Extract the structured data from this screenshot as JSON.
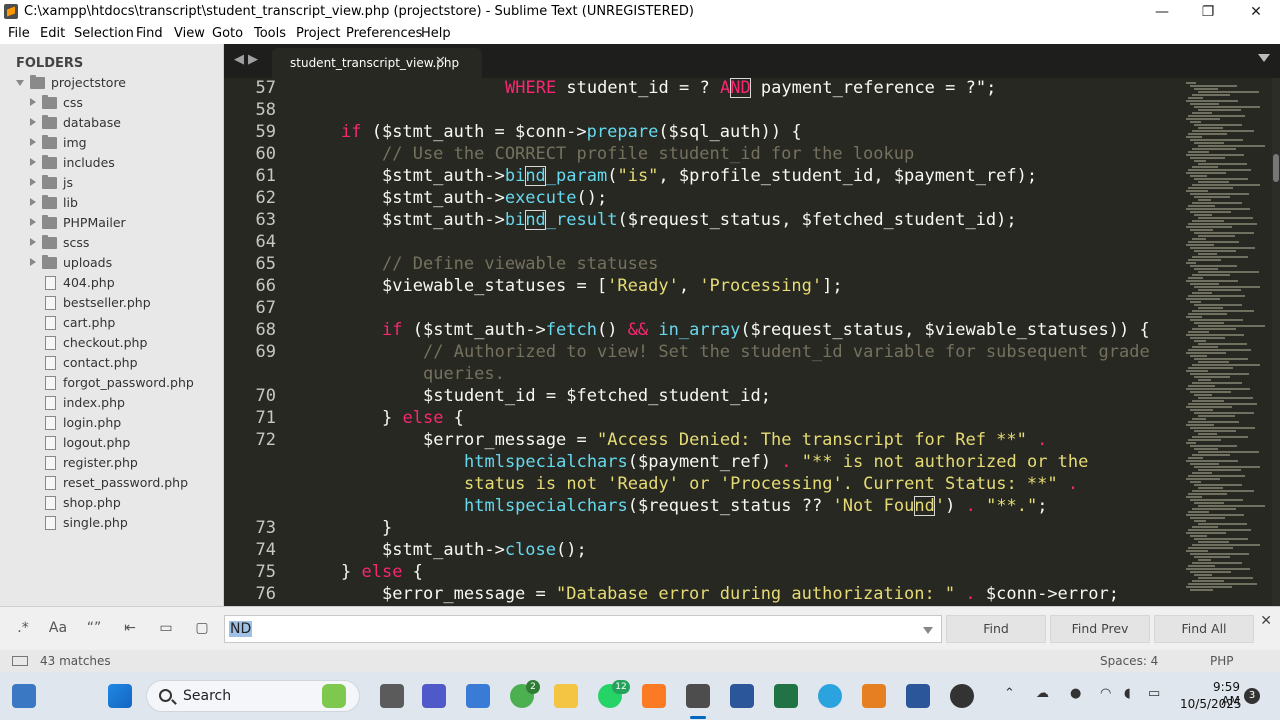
{
  "window": {
    "title": "C:\\xampp\\htdocs\\transcript\\student_transcript_view.php (projectstore) - Sublime Text (UNREGISTERED)",
    "minimize": "—",
    "maximize": "❐",
    "close": "✕"
  },
  "menu": [
    "File",
    "Edit",
    "Selection",
    "Find",
    "View",
    "Goto",
    "Tools",
    "Project",
    "Preferences",
    "Help"
  ],
  "sidebar": {
    "heading": "FOLDERS",
    "root": "projectstore",
    "folders": [
      "css",
      "database",
      "img",
      "includes",
      "js",
      "lib",
      "PHPMailer",
      "scss",
      "uploads"
    ],
    "files": [
      "404.php",
      "bestseller.php",
      "cart.php",
      "checkout.php",
      "contact.php",
      "forgot_password.php",
      "index.php",
      "login.php",
      "logout.php",
      "register.php",
      "reset_password.php",
      "shop.php",
      "single.php"
    ]
  },
  "tabs": {
    "nav_left": "◀",
    "nav_right": "▶",
    "active_tab": "student_transcript_view.php",
    "tab_close": "✕"
  },
  "editor": {
    "lines": [
      {
        "n": "57",
        "indent": 10,
        "parts": [
          [
            "kw",
            "WHERE "
          ],
          [
            "var",
            "student_id = ? "
          ],
          [
            "kw",
            "A"
          ],
          [
            "kwhl",
            "ND"
          ],
          [
            "var",
            " payment_reference = ?\";"
          ]
        ]
      },
      {
        "n": "58",
        "indent": 0,
        "parts": []
      },
      {
        "n": "59",
        "indent": 2,
        "parts": [
          [
            "kw",
            "if"
          ],
          [
            "var",
            " ($stmt_auth = $conn->"
          ],
          [
            "fn",
            "prepare"
          ],
          [
            "var",
            "($sql_auth)) {"
          ]
        ]
      },
      {
        "n": "60",
        "indent": 4,
        "parts": [
          [
            "cmt",
            "// Use the CORRECT profile student_id for the lookup"
          ]
        ]
      },
      {
        "n": "61",
        "indent": 4,
        "parts": [
          [
            "var",
            "$stmt_auth->"
          ],
          [
            "fn",
            "bi"
          ],
          [
            "fnhl",
            "nd"
          ],
          [
            "fn",
            "_param"
          ],
          [
            "var",
            "("
          ],
          [
            "str",
            "\"is\""
          ],
          [
            "var",
            ", $profile_student_id, $payment_ref);"
          ]
        ]
      },
      {
        "n": "62",
        "indent": 4,
        "parts": [
          [
            "var",
            "$stmt_auth->"
          ],
          [
            "fn",
            "execute"
          ],
          [
            "var",
            "();"
          ]
        ]
      },
      {
        "n": "63",
        "indent": 4,
        "parts": [
          [
            "var",
            "$stmt_auth->"
          ],
          [
            "fn",
            "bi"
          ],
          [
            "fnhl",
            "nd"
          ],
          [
            "fn",
            "_result"
          ],
          [
            "var",
            "($request_status, $fetched_student_id);"
          ]
        ]
      },
      {
        "n": "64",
        "indent": 0,
        "parts": []
      },
      {
        "n": "65",
        "indent": 4,
        "parts": [
          [
            "cmt",
            "// Define viewable statuses"
          ]
        ]
      },
      {
        "n": "66",
        "indent": 4,
        "parts": [
          [
            "var",
            "$viewable_statuses = ["
          ],
          [
            "str",
            "'Ready'"
          ],
          [
            "var",
            ", "
          ],
          [
            "str",
            "'Processing'"
          ],
          [
            "var",
            "];"
          ]
        ]
      },
      {
        "n": "67",
        "indent": 0,
        "parts": []
      },
      {
        "n": "68",
        "indent": 4,
        "parts": [
          [
            "kw",
            "if"
          ],
          [
            "var",
            " ($stmt_auth->"
          ],
          [
            "fn",
            "fetch"
          ],
          [
            "var",
            "() "
          ],
          [
            "kw",
            "&&"
          ],
          [
            "var",
            " "
          ],
          [
            "fn",
            "in_array"
          ],
          [
            "var",
            "($request_status, $viewable_statuses)) {"
          ]
        ]
      },
      {
        "n": "69",
        "indent": 6,
        "parts": [
          [
            "cmt",
            "// Authorized to view! Set the student_id variable for subsequent grade"
          ]
        ]
      },
      {
        "n": "",
        "indent": 6,
        "parts": [
          [
            "cmt",
            "queries."
          ]
        ]
      },
      {
        "n": "70",
        "indent": 6,
        "parts": [
          [
            "var",
            "$student_id = $fetched_student_id;"
          ]
        ]
      },
      {
        "n": "71",
        "indent": 4,
        "parts": [
          [
            "var",
            "} "
          ],
          [
            "kw",
            "else"
          ],
          [
            "var",
            " {"
          ]
        ]
      },
      {
        "n": "72",
        "indent": 6,
        "parts": [
          [
            "var",
            "$error_message = "
          ],
          [
            "str",
            "\"Access Denied: The transcript for Ref **\""
          ],
          [
            "var",
            " "
          ],
          [
            "kw",
            "."
          ]
        ]
      },
      {
        "n": "",
        "indent": 8,
        "parts": [
          [
            "fn",
            "htmlspecialchars"
          ],
          [
            "var",
            "($payment_ref) "
          ],
          [
            "kw",
            "."
          ],
          [
            "var",
            " "
          ],
          [
            "str",
            "\"** is not authorized or the"
          ]
        ]
      },
      {
        "n": "",
        "indent": 8,
        "parts": [
          [
            "str",
            "status is not 'Ready' or 'Processing'. Current Status: **\""
          ],
          [
            "var",
            " "
          ],
          [
            "kw",
            "."
          ]
        ]
      },
      {
        "n": "",
        "indent": 8,
        "parts": [
          [
            "fn",
            "htmlspecialchars"
          ],
          [
            "var",
            "($request_status ?? "
          ],
          [
            "str",
            "'Not Fou"
          ],
          [
            "strhl",
            "nd"
          ],
          [
            "str",
            "'"
          ],
          [
            "var",
            ") "
          ],
          [
            "kw",
            "."
          ],
          [
            "var",
            " "
          ],
          [
            "str",
            "\"**.\""
          ],
          [
            "var",
            ";"
          ]
        ]
      },
      {
        "n": "73",
        "indent": 4,
        "parts": [
          [
            "var",
            "}"
          ]
        ]
      },
      {
        "n": "74",
        "indent": 4,
        "parts": [
          [
            "var",
            "$stmt_auth->"
          ],
          [
            "fn",
            "close"
          ],
          [
            "var",
            "();"
          ]
        ]
      },
      {
        "n": "75",
        "indent": 2,
        "parts": [
          [
            "var",
            "} "
          ],
          [
            "kw",
            "else"
          ],
          [
            "var",
            " {"
          ]
        ]
      },
      {
        "n": "76",
        "indent": 4,
        "parts": [
          [
            "var",
            "$error_message = "
          ],
          [
            "str",
            "\"Database error during authorization: \""
          ],
          [
            "var",
            " "
          ],
          [
            "kw",
            "."
          ],
          [
            "var",
            " $conn->error;"
          ]
        ]
      }
    ]
  },
  "find_panel": {
    "options": [
      ".*",
      "Aa",
      "“”",
      "⇤",
      "▭",
      "▢"
    ],
    "query": "ND",
    "find_label": "Find",
    "find_prev_label": "Find Prev",
    "find_all_label": "Find All",
    "close": "✕"
  },
  "status": {
    "matches": "43 matches",
    "spaces": "Spaces: 4",
    "syntax": "PHP"
  },
  "taskbar": {
    "search_label": "Search",
    "chrome_badge": "2",
    "whatsapp_badge": "12",
    "time": "9:59 AM",
    "date": "10/5/2025",
    "notifications": "3",
    "icons": [
      "widgets-icon",
      "start-icon",
      "search-icon",
      "photos-icon",
      "task-view-icon",
      "teams-icon",
      "store-icon",
      "chrome-icon",
      "file-explorer-icon",
      "whatsapp-icon",
      "xampp-icon",
      "sublime-icon",
      "word-icon",
      "excel-icon",
      "telegram-icon",
      "office-icon",
      "notes-icon",
      "obs-icon"
    ],
    "colors": {
      "word": "#2b579a",
      "excel": "#217346",
      "telegram": "#2aa3de",
      "chrome": "#4caf50",
      "sublime": "#ff9800",
      "whatsapp": "#25d366",
      "xampp": "#fb7a24",
      "explorer": "#f4c542",
      "teams": "#5059c9",
      "store": "#3a7bd5",
      "office": "#e67e22",
      "notes": "#2b579a",
      "obs": "#333333"
    }
  },
  "theme": {
    "editor_bg": "#272822",
    "keyword": "#f92672",
    "string": "#e6db74",
    "function": "#66d9ef",
    "comment": "#75715e",
    "text": "#f8f8f2"
  }
}
